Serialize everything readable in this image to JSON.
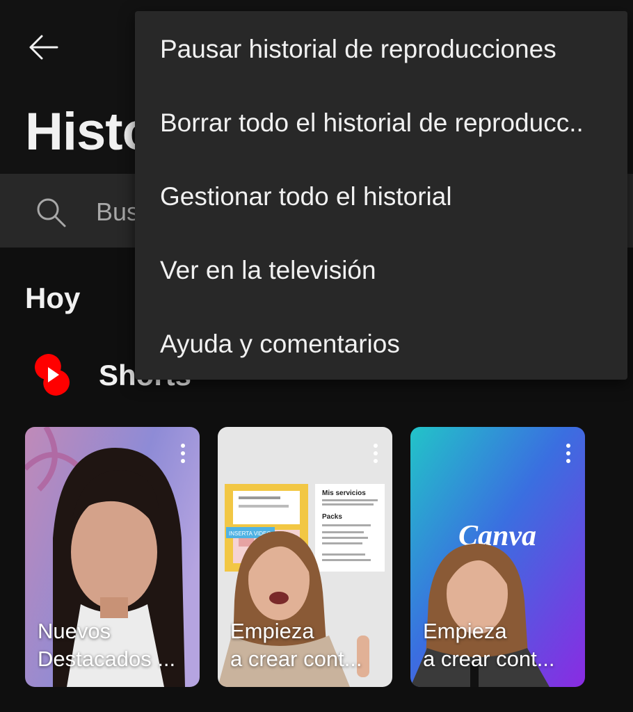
{
  "header": {
    "title": "Historial"
  },
  "search": {
    "placeholder": "Buscar en el historial"
  },
  "section": {
    "heading": "Hoy"
  },
  "shorts": {
    "title": "Shorts",
    "logo_color": "#ff0000"
  },
  "cards": [
    {
      "line1": "Nuevos",
      "line2": "Destacados ..."
    },
    {
      "line1": "Empieza",
      "line2": "a crear cont..."
    },
    {
      "line1": "Empieza",
      "line2": "a crear cont...",
      "brand": "Canva"
    }
  ],
  "card_thumb": {
    "heading": "Mis servicios",
    "packs": "Packs",
    "banner": "INSERTA VIDEO"
  },
  "menu": {
    "items": [
      "Pausar historial de reproducciones",
      "Borrar todo el historial de reproducc..",
      "Gestionar todo el historial",
      "Ver en la televisión",
      "Ayuda y comentarios"
    ]
  },
  "icons": {
    "back": "arrow-left-icon",
    "search": "search-icon",
    "more": "more-vert-icon",
    "shorts": "shorts-logo-icon"
  },
  "colors": {
    "background": "#0f0f0f",
    "menu": "#282828",
    "search_bar": "#282828",
    "text": "#f1f1f1"
  }
}
